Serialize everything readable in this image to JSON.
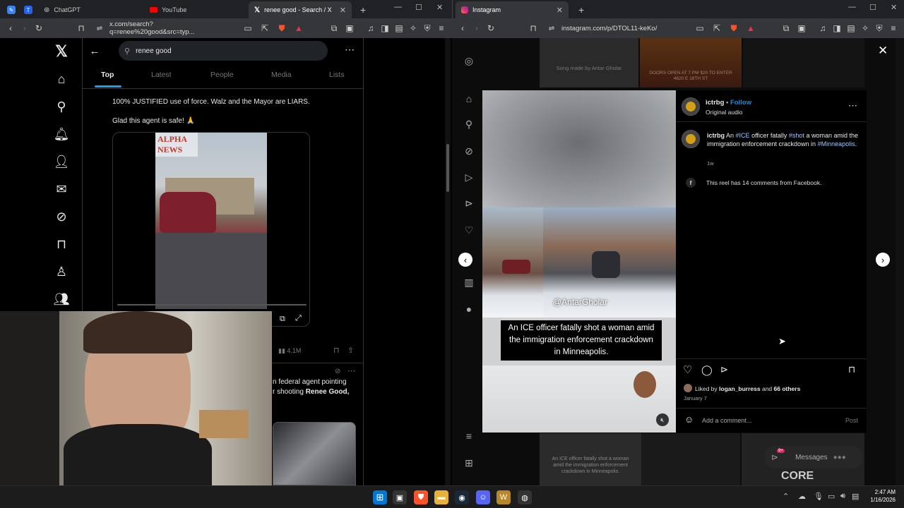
{
  "left_window": {
    "tabs": [
      {
        "title": "ChatGPT"
      },
      {
        "title": "YouTube"
      },
      {
        "title": "renee good - Search / X"
      }
    ],
    "url": "x.com/search?q=renee%20good&src=typ..."
  },
  "x_app": {
    "search_value": "renee good",
    "tabs": [
      "Top",
      "Latest",
      "People",
      "Media",
      "Lists"
    ],
    "post": {
      "line1": "100% JUSTIFIED use of force. Walz and the Mayor are LIARS.",
      "line2": "Glad this agent is safe! 🙏",
      "video_watermark": "ALPHA NEWS",
      "views": "4.1M"
    },
    "post2": {
      "line1": "n federal agent pointing",
      "line2_prefix": "r shooting ",
      "line2_bold": "Renee Good,"
    }
  },
  "right_window": {
    "tabs": [
      {
        "title": "Instagram"
      }
    ],
    "url": "instagram.com/p/DTOL11-keKo/"
  },
  "instagram": {
    "bg_caption": "Song made by Antar Gholar",
    "bg_flyer": "DOORS OPEN AT 7 PM $20 TO ENTER 4620 E 18TH ST",
    "username": "ictrbg",
    "follow": "Follow",
    "audio": "Original audio",
    "caption_user": "ictrbg",
    "caption_parts": [
      "An ",
      "#ICE",
      " officer fatally ",
      "#shot",
      " a woman amid the immigration enforcement crackdown in ",
      "#Minneapolis",
      "."
    ],
    "caption_age": "1w",
    "facebook_note": "This reel has 14 comments from Facebook.",
    "video_handle": "@AntarGholar",
    "video_subtitle": "An ICE officer fatally shot a woman amid the immigration enforcement crackdown in Minneapolis.",
    "liked_prefix": "Liked by ",
    "liked_user": "logan_burress",
    "liked_mid": " and ",
    "liked_count": "66 others",
    "date": "January 7",
    "comment_placeholder": "Add a comment...",
    "post_button": "Post",
    "messages_label": "Messages",
    "messages_badge": "9+",
    "bottom_text": "CORE",
    "bottom_caption": "An ICE officer fatally shot a woman amid the immigration enforcement crackdown in Minneapolis."
  },
  "taskbar": {
    "time": "2:47 AM",
    "date": "1/16/2026"
  }
}
